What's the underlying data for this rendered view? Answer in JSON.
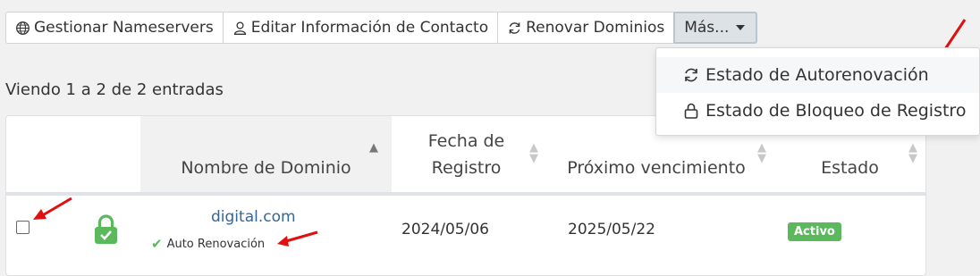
{
  "toolbar": {
    "manage_ns": {
      "icon": "globe-icon",
      "label": "Gestionar Nameservers"
    },
    "edit_contact": {
      "icon": "user-icon",
      "label": "Editar Información de Contacto"
    },
    "renew": {
      "icon": "refresh-icon",
      "label": "Renovar Dominios"
    },
    "more": {
      "label": "Más..."
    }
  },
  "dropdown": {
    "items": [
      {
        "icon": "refresh-icon",
        "label": "Estado de Autorenovación",
        "highlighted": true
      },
      {
        "icon": "lock-icon",
        "label": "Estado de Bloqueo de Registro",
        "highlighted": false
      }
    ]
  },
  "listing": {
    "info": "Viendo 1 a 2 de 2 entradas"
  },
  "table": {
    "columns": [
      {
        "label": "Nombre de Dominio",
        "sorted": true
      },
      {
        "label": "Fecha de Registro",
        "sorted": false
      },
      {
        "label": "Próximo vencimiento",
        "sorted": false
      },
      {
        "label": "Estado",
        "sorted": false
      }
    ],
    "rows": [
      {
        "domain": "digital.com",
        "auto_renew_label": "Auto Renovación",
        "registration_date": "2024/05/06",
        "next_due": "2025/05/22",
        "status": "Activo"
      }
    ]
  },
  "colors": {
    "link": "#336699",
    "status_active": "#5cb85c",
    "annotation_arrow": "#e01010",
    "lock_icon": "#5cb85c"
  }
}
